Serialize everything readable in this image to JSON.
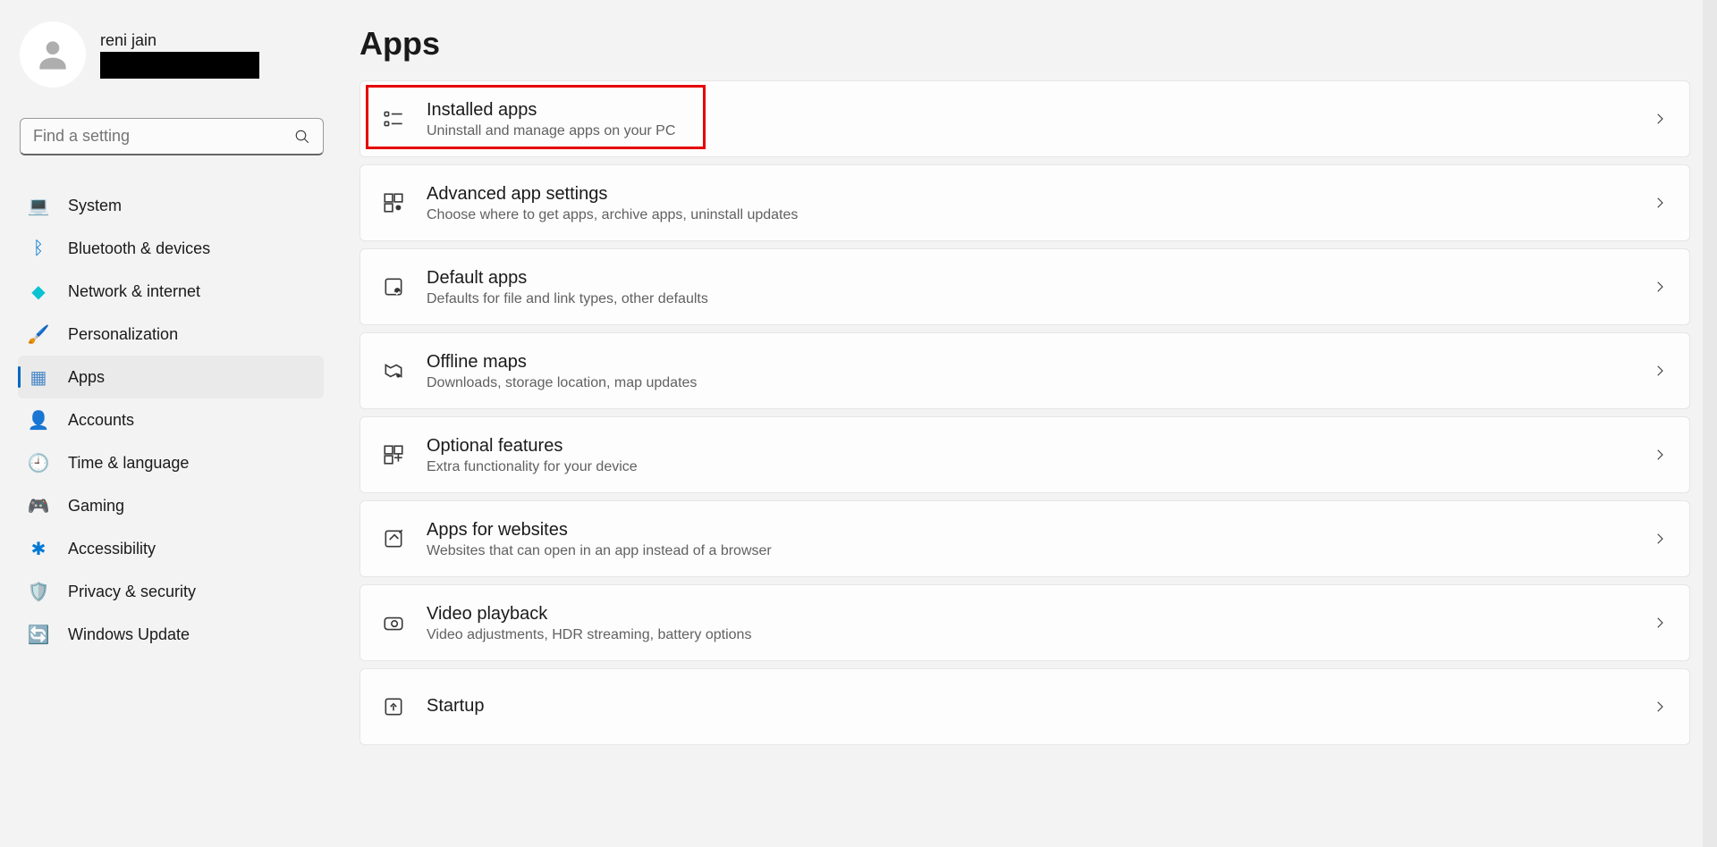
{
  "profile": {
    "name": "reni jain"
  },
  "search": {
    "placeholder": "Find a setting"
  },
  "nav": [
    {
      "label": "System",
      "icon": "💻",
      "color": "#0078d4"
    },
    {
      "label": "Bluetooth & devices",
      "icon": "ᛒ",
      "color": "#0078d4"
    },
    {
      "label": "Network & internet",
      "icon": "◆",
      "color": "#0ac2d2"
    },
    {
      "label": "Personalization",
      "icon": "🖌️",
      "color": ""
    },
    {
      "label": "Apps",
      "icon": "▦",
      "color": "#4a88c7",
      "active": true
    },
    {
      "label": "Accounts",
      "icon": "👤",
      "color": "#0078d4"
    },
    {
      "label": "Time & language",
      "icon": "🕘",
      "color": ""
    },
    {
      "label": "Gaming",
      "icon": "🎮",
      "color": "#9b9b9b"
    },
    {
      "label": "Accessibility",
      "icon": "✱",
      "color": "#0078d4"
    },
    {
      "label": "Privacy & security",
      "icon": "🛡️",
      "color": "#9b9b9b"
    },
    {
      "label": "Windows Update",
      "icon": "🔄",
      "color": "#0078d4"
    }
  ],
  "page": {
    "title": "Apps"
  },
  "cards": [
    {
      "title": "Installed apps",
      "desc": "Uninstall and manage apps on your PC",
      "highlight": true
    },
    {
      "title": "Advanced app settings",
      "desc": "Choose where to get apps, archive apps, uninstall updates"
    },
    {
      "title": "Default apps",
      "desc": "Defaults for file and link types, other defaults"
    },
    {
      "title": "Offline maps",
      "desc": "Downloads, storage location, map updates"
    },
    {
      "title": "Optional features",
      "desc": "Extra functionality for your device"
    },
    {
      "title": "Apps for websites",
      "desc": "Websites that can open in an app instead of a browser"
    },
    {
      "title": "Video playback",
      "desc": "Video adjustments, HDR streaming, battery options"
    },
    {
      "title": "Startup",
      "desc": ""
    }
  ]
}
